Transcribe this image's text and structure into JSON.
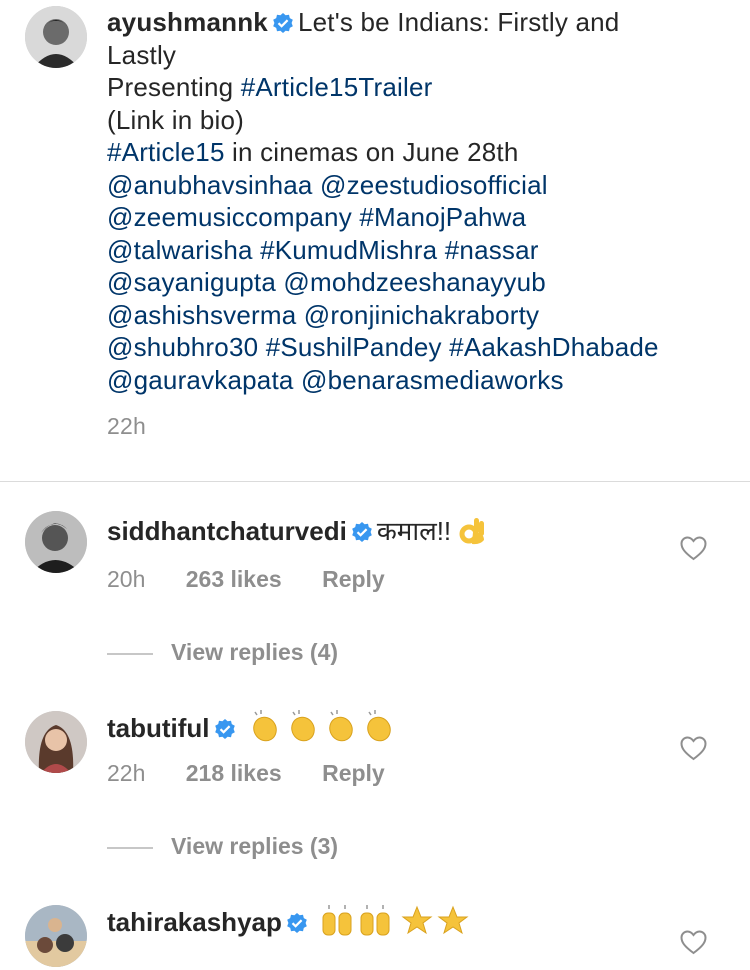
{
  "post": {
    "username": "ayushmannk",
    "caption_lines": [
      "Let's be Indians: Firstly and",
      "Lastly",
      "Presenting ",
      "#Article15Trailer",
      "(Link in bio)",
      "#Article15",
      " in cinemas on June 28th",
      "@anubhavsinhaa @zeestudiosofficial",
      "@zeemusiccompany #ManojPahwa",
      "@talwarisha #KumudMishra #nassar",
      "@sayanigupta @mohdzeeshanayyub",
      "@ashishsverma @ronjinichakraborty",
      "@shubhro30 #SushilPandey #AakashDhabade",
      "@gauravkapata @benarasmediaworks"
    ],
    "time": "22h"
  },
  "comments": [
    {
      "username": "siddhantchaturvedi",
      "text": "कमाल!!",
      "emoji": "ok-hand-emoji",
      "time": "20h",
      "likes": "263 likes",
      "reply": "Reply",
      "view_replies": "View replies (4)"
    },
    {
      "username": "tabutiful",
      "text": "",
      "emoji": "clapping-hands-emoji x4",
      "time": "22h",
      "likes": "218 likes",
      "reply": "Reply",
      "view_replies": "View replies (3)"
    },
    {
      "username": "tahirakashyap",
      "text": "",
      "emoji": "raised-hands-emoji x2, star-emoji x2"
    }
  ],
  "colors": {
    "link": "#003569",
    "verified": "#3897f0",
    "muted": "#8e8e8e",
    "text": "#262626"
  }
}
